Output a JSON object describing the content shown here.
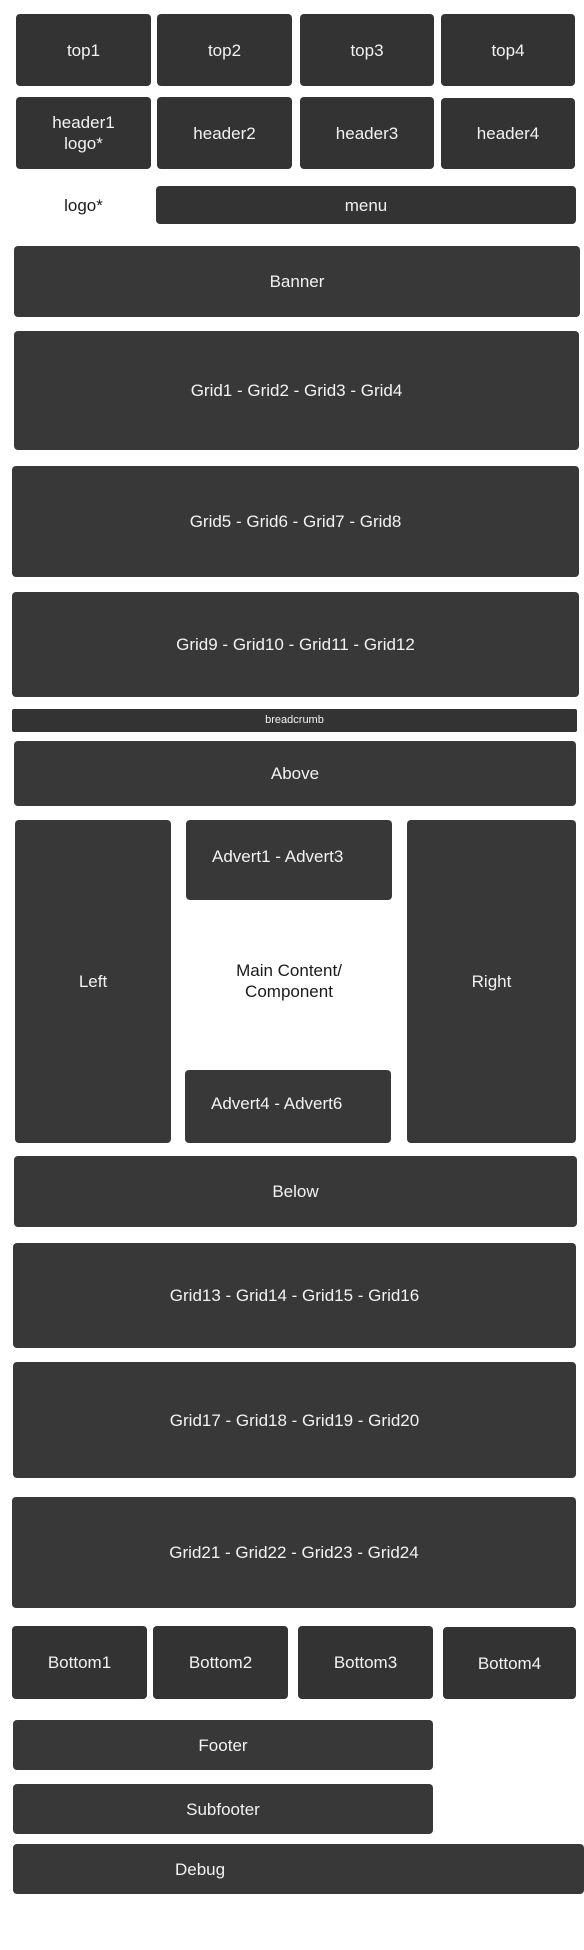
{
  "top": [
    "top1",
    "top2",
    "top3",
    "top4"
  ],
  "header": {
    "header1": [
      "header1",
      "logo*"
    ],
    "header2": "header2",
    "header3": "header3",
    "header4": "header4"
  },
  "logo": "logo*",
  "menu": "menu",
  "banner": "Banner",
  "grids": [
    "Grid1 - Grid2 - Grid3 - Grid4",
    "Grid5 - Grid6 - Grid7 - Grid8",
    "Grid9 - Grid10 - Grid11 - Grid12"
  ],
  "breadcrumb": "breadcrumb",
  "above": "Above",
  "left": "Left",
  "adverts_top": "Advert1 - Advert3",
  "main_content": [
    "Main Content/",
    "Component"
  ],
  "adverts_bottom": "Advert4 - Advert6",
  "right": "Right",
  "below": "Below",
  "grids_bottom": [
    "Grid13 - Grid14 - Grid15 - Grid16",
    "Grid17 - Grid18 - Grid19 - Grid20",
    "Grid21 - Grid22 - Grid23 - Grid24"
  ],
  "bottom": [
    "Bottom1",
    "Bottom2",
    "Bottom3",
    "Bottom4"
  ],
  "footer": "Footer",
  "subfooter": "Subfooter",
  "debug": "Debug"
}
